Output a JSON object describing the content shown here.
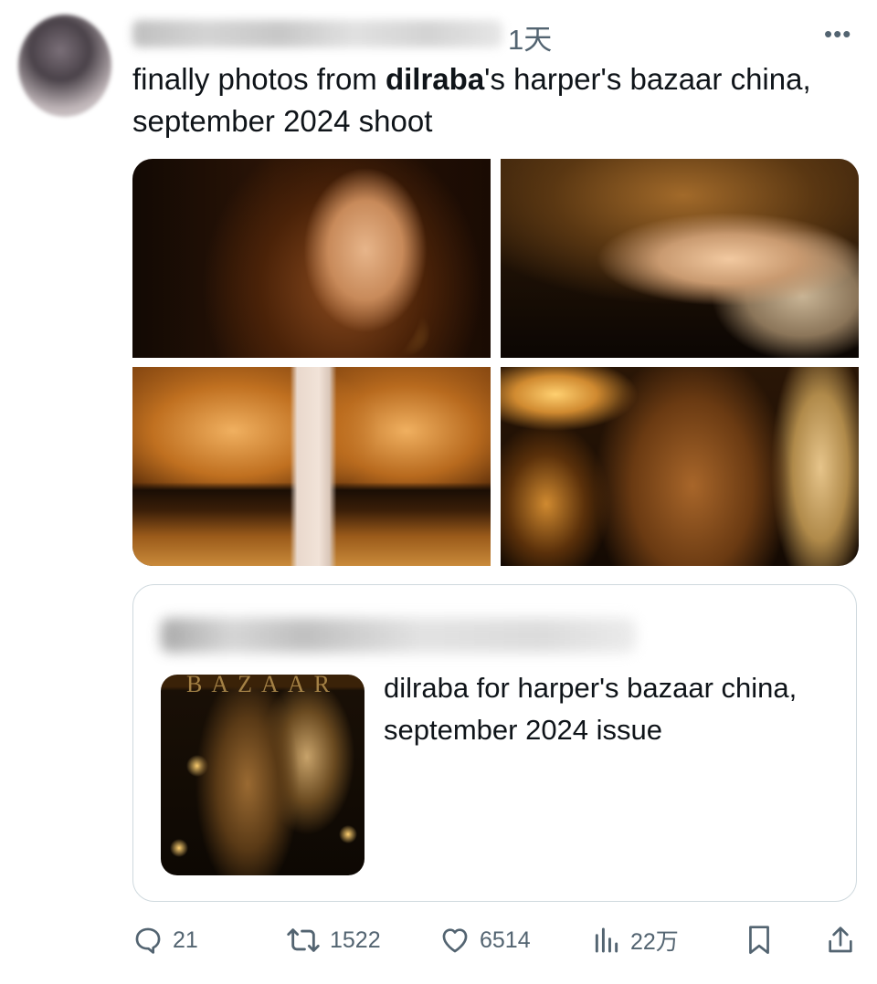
{
  "tweet": {
    "time": "1天",
    "more_icon": "more-horizontal-icon",
    "text_before": "finally photos from ",
    "text_bold": "dilraba",
    "text_after": "'s harper's bazaar china, september 2024 shoot"
  },
  "quote": {
    "thumb_masthead": "BAZAAR",
    "text": "dilraba for harper's bazaar china, september 2024 issue"
  },
  "actions": {
    "reply": {
      "icon": "reply-icon",
      "count": "21"
    },
    "retweet": {
      "icon": "retweet-icon",
      "count": "1522"
    },
    "like": {
      "icon": "heart-icon",
      "count": "6514"
    },
    "views": {
      "icon": "views-chart-icon",
      "count": "22万"
    },
    "bookmark": {
      "icon": "bookmark-icon"
    },
    "share": {
      "icon": "share-icon"
    }
  },
  "colors": {
    "text": "#0f1419",
    "secondary": "#536471",
    "border": "#cfd9de"
  }
}
